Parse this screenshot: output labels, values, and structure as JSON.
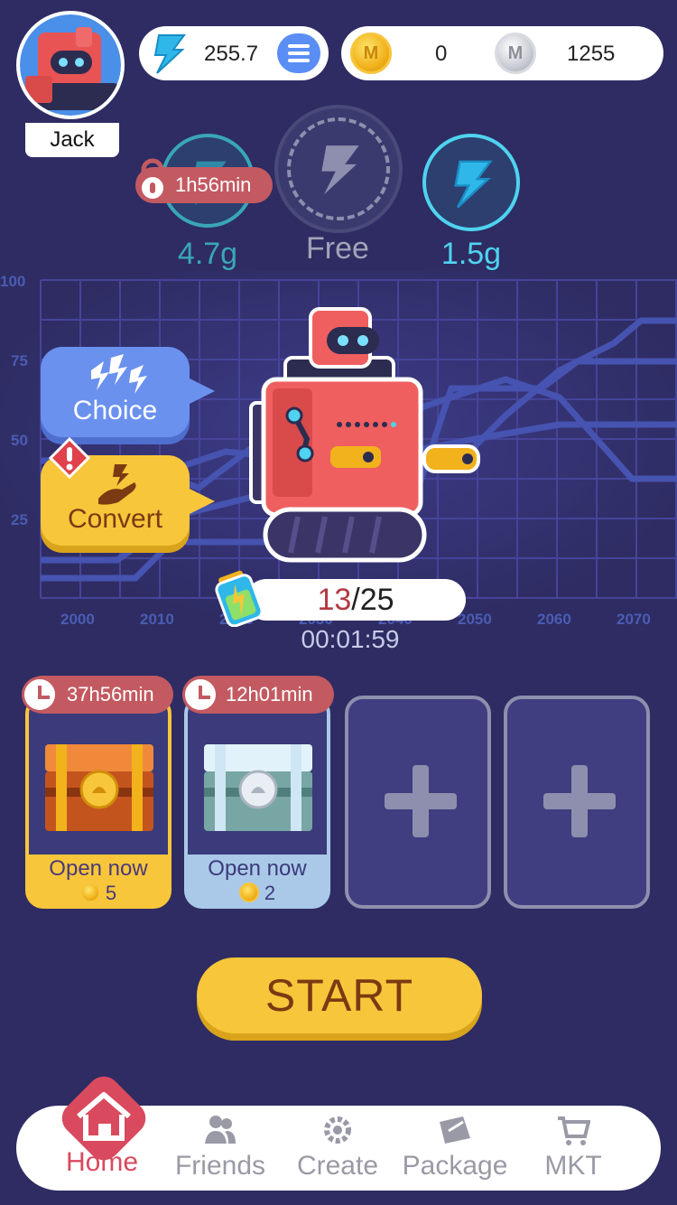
{
  "player": {
    "name": "Jack"
  },
  "resources": {
    "energy": "255.7",
    "gold_coins": "0",
    "silver_coins": "1255"
  },
  "energy_options": [
    {
      "label": "4.7g",
      "locked": true,
      "lock_timer": "1h56min",
      "color": "#3aa6b8"
    },
    {
      "label": "Free",
      "color": "#a3a3b8"
    },
    {
      "label": "1.5g",
      "color": "#4fd3f0"
    }
  ],
  "chart": {
    "y_ticks": [
      "100",
      "75",
      "50",
      "25"
    ],
    "x_ticks": [
      "2000",
      "2010",
      "2020",
      "2030",
      "2040",
      "2050",
      "2060",
      "2070"
    ]
  },
  "actions": {
    "choice_label": "Choice",
    "convert_label": "Convert"
  },
  "battery": {
    "current": "13",
    "max": "/25",
    "timer": "00:01:59"
  },
  "chests": [
    {
      "timer": "37h56min",
      "open_label": "Open now",
      "cost": "5",
      "type": "gold"
    },
    {
      "timer": "12h01min",
      "open_label": "Open now",
      "cost": "2",
      "type": "silver"
    }
  ],
  "start_label": "START",
  "nav": {
    "home": "Home",
    "friends": "Friends",
    "create": "Create",
    "package": "Package",
    "mkt": "MKT"
  },
  "colors": {
    "background": "#2e2c62",
    "accent_yellow": "#f8c63a",
    "accent_red": "#c35a61",
    "accent_blue": "#6b91ef"
  }
}
